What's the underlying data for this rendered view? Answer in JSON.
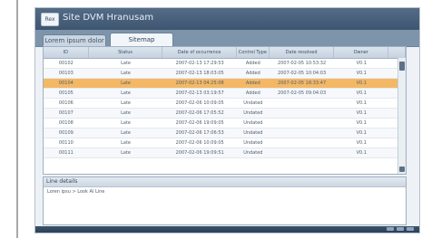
{
  "window": {
    "logo_text": "Rex",
    "title": "Site DVM Hranusam"
  },
  "tabs": [
    {
      "label": "Lorem ipsum dolor"
    },
    {
      "label": "Sitemap"
    }
  ],
  "grid": {
    "columns": [
      "ID",
      "Status",
      "Date of occurrence",
      "Control Type",
      "Date resolved",
      "Owner",
      ""
    ],
    "rows": [
      {
        "cells": [
          "00102",
          "Late",
          "2007-02-13 17:29:53",
          "Added",
          "2007-02-05 10:53:32",
          "V0.1",
          ""
        ],
        "selected": false
      },
      {
        "cells": [
          "00103",
          "Late",
          "2007-02-13 18:03:05",
          "Added",
          "2007-02-05 10:04:03",
          "V0.1",
          ""
        ],
        "selected": false
      },
      {
        "cells": [
          "00104",
          "Late",
          "2007-02-13 04:25:08",
          "Added",
          "2007-02-05 18:33:47",
          "V0.1",
          ""
        ],
        "selected": true
      },
      {
        "cells": [
          "00105",
          "Late",
          "2007-02-13 03:19:57",
          "Added",
          "2007-02-05 09:04:03",
          "V0.1",
          ""
        ],
        "selected": false
      },
      {
        "cells": [
          "00106",
          "Late",
          "2007-02-06 10:09:05",
          "Undated",
          "",
          "V0.1",
          ""
        ],
        "selected": false
      },
      {
        "cells": [
          "00107",
          "Late",
          "2007-02-06 17:05:52",
          "Undated",
          "",
          "V0.1",
          ""
        ],
        "selected": false
      },
      {
        "cells": [
          "00108",
          "Late",
          "2007-02-06 19:09:05",
          "Undated",
          "",
          "V0.1",
          ""
        ],
        "selected": false
      },
      {
        "cells": [
          "00109",
          "Late",
          "2007-02-06 17:06:53",
          "Undated",
          "",
          "V0.1",
          ""
        ],
        "selected": false
      },
      {
        "cells": [
          "00110",
          "Late",
          "2007-02-06 10:09:05",
          "Undated",
          "",
          "V0.1",
          ""
        ],
        "selected": false
      },
      {
        "cells": [
          "00111",
          "Late",
          "2007-02-06 19:09:51",
          "Undated",
          "",
          "V0.1",
          ""
        ],
        "selected": false
      }
    ]
  },
  "details": {
    "title": "Line details",
    "body": "Loren ipsu > Look Al Line"
  },
  "colors": {
    "titlebar": "#4b6380",
    "selected_row": "#f4b865",
    "tab_strip": "#7e94ab"
  }
}
